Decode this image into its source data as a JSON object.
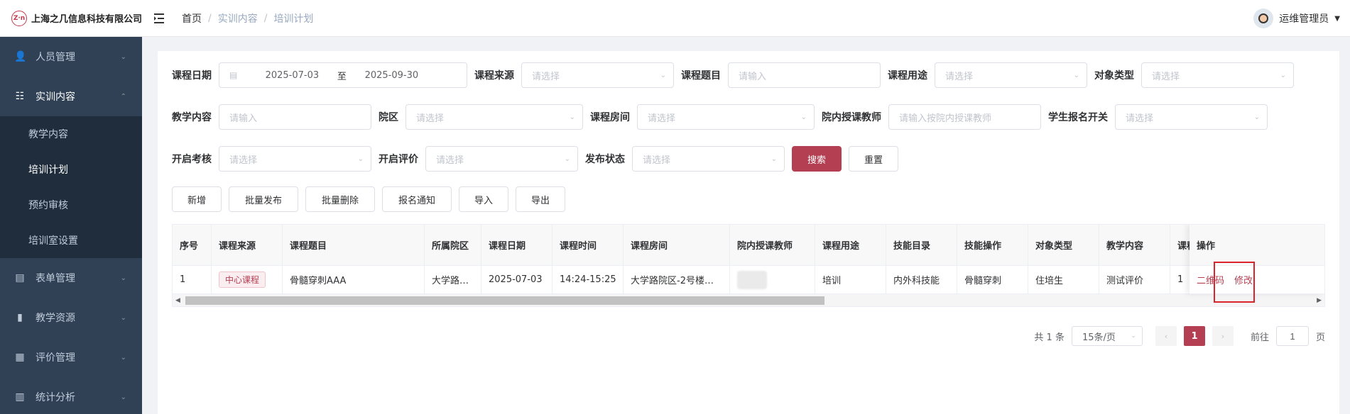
{
  "header": {
    "company": "上海之几信息科技有限公司",
    "logo_mark": "Z·n",
    "breadcrumb": [
      "首页",
      "实训内容",
      "培训计划"
    ],
    "user_name": "运维管理员"
  },
  "sidebar": {
    "items": [
      {
        "label": "人员管理",
        "icon": "people-icon"
      },
      {
        "label": "实训内容",
        "icon": "content-icon"
      },
      {
        "label": "表单管理",
        "icon": "form-icon"
      },
      {
        "label": "教学资源",
        "icon": "resource-icon"
      },
      {
        "label": "评价管理",
        "icon": "evaluation-icon"
      },
      {
        "label": "统计分析",
        "icon": "stats-icon"
      }
    ],
    "submenu": [
      "教学内容",
      "培训计划",
      "预约审核",
      "培训室设置"
    ]
  },
  "filters": {
    "course_date": "课程日期",
    "date_start": "2025-07-03",
    "date_to": "至",
    "date_end": "2025-09-30",
    "course_source": "课程来源",
    "course_topic": "课程题目",
    "course_use": "课程用途",
    "target_type": "对象类型",
    "teaching_content": "教学内容",
    "campus": "院区",
    "course_room": "课程房间",
    "teacher": "院内授课教师",
    "signup_switch": "学生报名开关",
    "open_exam": "开启考核",
    "open_eval": "开启评价",
    "publish_status": "发布状态",
    "ph_select": "请选择",
    "ph_input": "请输入",
    "ph_teacher": "请输入按院内授课教师",
    "search": "搜索",
    "reset": "重置"
  },
  "toolbar": [
    "新增",
    "批量发布",
    "批量删除",
    "报名通知",
    "导入",
    "导出"
  ],
  "table": {
    "headers": [
      "序号",
      "课程来源",
      "课程题目",
      "所属院区",
      "课程日期",
      "课程时间",
      "课程房间",
      "院内授课教师",
      "课程用途",
      "技能目录",
      "技能操作",
      "对象类型",
      "教学内容",
      "课程"
    ],
    "operation_header": "操作",
    "row": {
      "index": "1",
      "source": "中心课程",
      "topic": "骨髓穿刺AAA",
      "campus": "大学路…",
      "date": "2025-07-03",
      "time": "14:24-15:25",
      "room": "大学路院区-2号楼…",
      "use": "培训",
      "catalog": "内外科技能",
      "operation": "骨髓穿刺",
      "target": "住培生",
      "content": "测试评价",
      "extra": "1",
      "qr": "二维码",
      "edit": "修改"
    }
  },
  "pager": {
    "total": "共 1 条",
    "page_size": "15条/页",
    "current": "1",
    "goto": "前往",
    "goto_value": "1",
    "page_suffix": "页"
  }
}
